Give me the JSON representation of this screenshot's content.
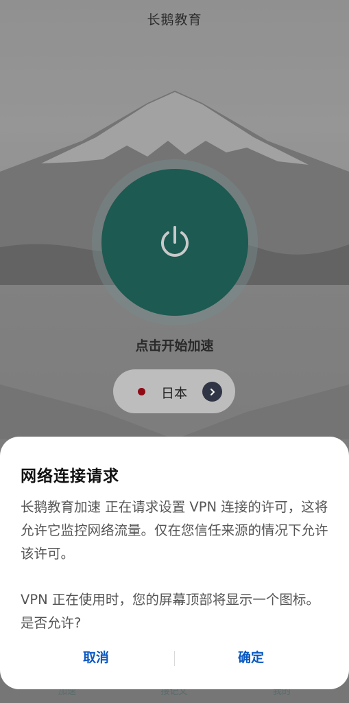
{
  "app": {
    "title": "长鹅教育"
  },
  "main": {
    "start_label": "点击开始加速",
    "region": {
      "name": "日本",
      "flag_color": "#8f0a14"
    },
    "power_button_color": "#1c5a52"
  },
  "bottom_nav": {
    "items": [
      "加速",
      "接记文",
      "我的"
    ]
  },
  "dialog": {
    "title": "网络连接请求",
    "body_para1": "长鹅教育加速 正在请求设置 VPN 连接的许可，这将允许它监控网络流量。仅在您信任来源的情况下允许该许可。",
    "body_para2": "VPN 正在使用时，您的屏幕顶部将显示一个图标。 是否允许?",
    "cancel_label": "取消",
    "confirm_label": "确定",
    "accent_color": "#0a59c2"
  },
  "icons": {
    "power": "power-icon",
    "arrow": "chevron-right-icon"
  }
}
